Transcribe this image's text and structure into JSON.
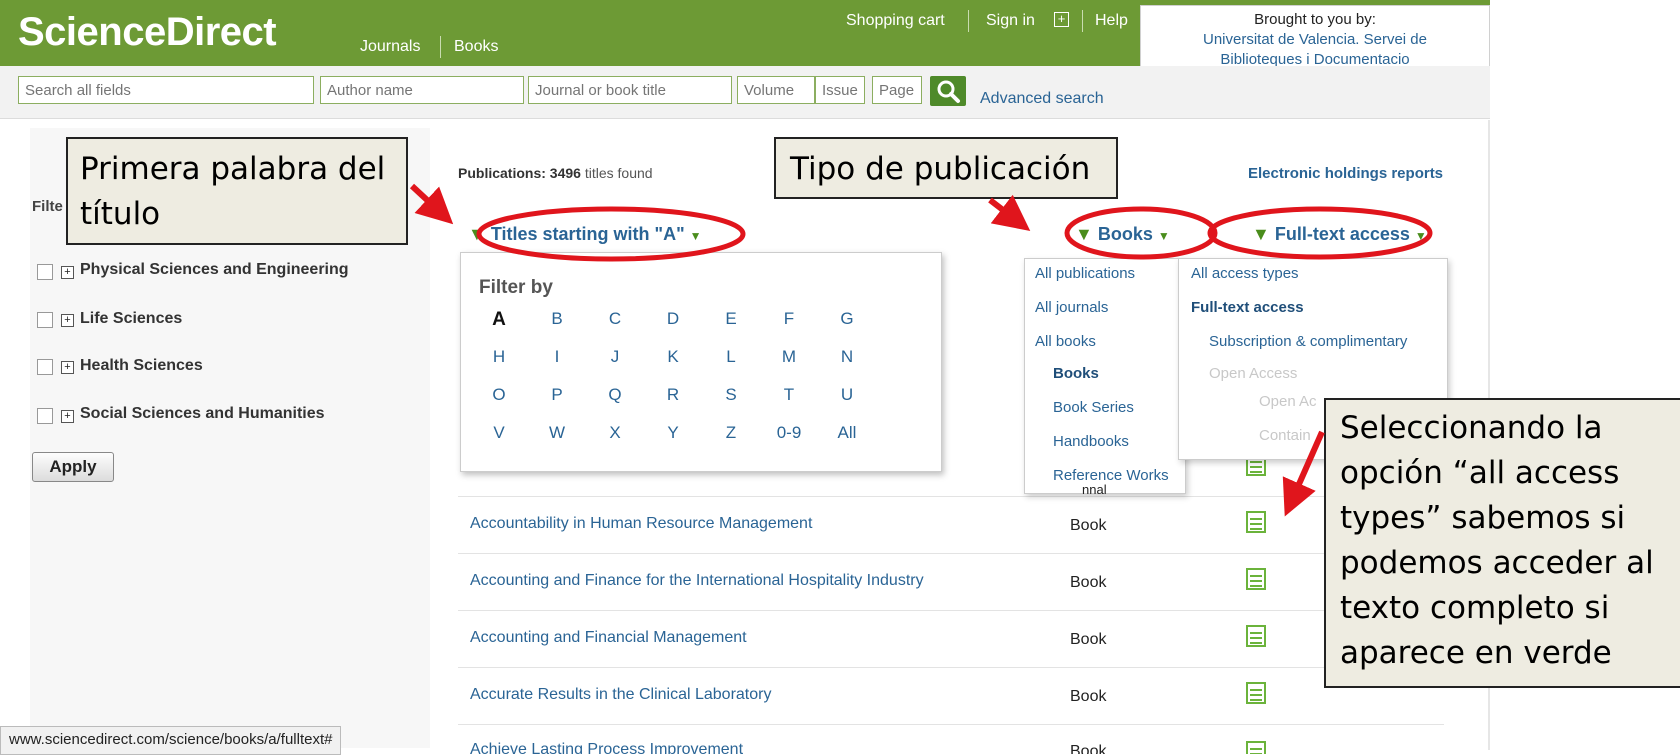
{
  "header": {
    "logo": "ScienceDirect",
    "nav": [
      "Journals",
      "Books"
    ],
    "top_links": [
      "Shopping cart",
      "Sign in",
      "Help"
    ],
    "brought_label": "Brought to you by:",
    "institution_line1": "Universitat de Valencia. Servei de",
    "institution_line2": "Biblioteques i Documentacio"
  },
  "search": {
    "all_fields": "Search all fields",
    "author": "Author name",
    "journal": "Journal or book title",
    "volume": "Volume",
    "issue": "Issue",
    "page": "Page",
    "advanced": "Advanced search"
  },
  "sidebar": {
    "filter_label_partial": "Filte",
    "categories": [
      "Physical Sciences and Engineering",
      "Life Sciences",
      "Health Sciences",
      "Social Sciences and Humanities"
    ],
    "apply": "Apply"
  },
  "results": {
    "count_label": "Publications:",
    "count_value": "3496",
    "count_suffix": "titles found",
    "holdings_link": "Electronic holdings reports",
    "letter_filter": "Titles starting with \"A\"",
    "type_filter": "Books",
    "access_filter": "Full-text access",
    "rows": [
      {
        "title": "Accountability in Human Resource Management",
        "type": "Book"
      },
      {
        "title": "Accounting and Finance for the International Hospitality Industry",
        "type": "Book"
      },
      {
        "title": "Accounting and Financial Management",
        "type": "Book"
      },
      {
        "title": "Accurate Results in the Clinical Laboratory",
        "type": "Book"
      },
      {
        "title": "Achieve Lasting Process Improvement",
        "type": "Book"
      }
    ]
  },
  "letter_popup": {
    "title": "Filter by",
    "selected": "A",
    "letters": [
      "A",
      "B",
      "C",
      "D",
      "E",
      "F",
      "G",
      "H",
      "I",
      "J",
      "K",
      "L",
      "M",
      "N",
      "O",
      "P",
      "Q",
      "R",
      "S",
      "T",
      "U",
      "V",
      "W",
      "X",
      "Y",
      "Z",
      "0-9",
      "All"
    ]
  },
  "pub_dropdown": {
    "items": [
      "All publications",
      "All journals",
      "All books",
      "Books",
      "Book Series",
      "Handbooks",
      "Reference Works"
    ],
    "partial_text": "nnal"
  },
  "access_dropdown": {
    "items": [
      "All access types",
      "Full-text access",
      "Subscription & complimentary",
      "Open Access",
      "Open Ac",
      "Contain"
    ]
  },
  "annotations": {
    "first_word": [
      "Primera palabra del",
      "título"
    ],
    "pub_type": "Tipo de publicación",
    "access_note": [
      "Seleccionando la",
      "opción “all access",
      "types” sabemos si",
      "podemos acceder al",
      "texto completo si",
      "aparece en verde"
    ]
  },
  "status_bar": "www.sciencedirect.com/science/books/a/fulltext#",
  "colors": {
    "header_green": "#6d9a35",
    "link_blue": "#2a6495",
    "annotation_red": "#e0151c",
    "callout_bg": "#eeece1"
  }
}
